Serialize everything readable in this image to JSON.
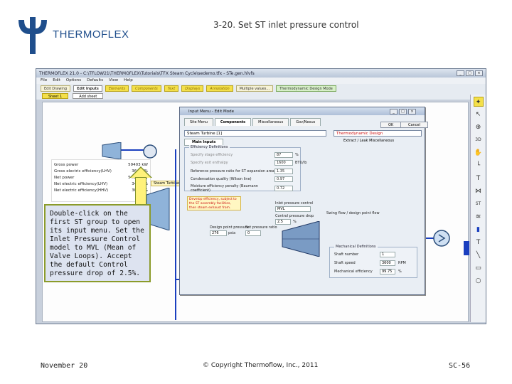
{
  "brand": {
    "name": "THERMOFLEX",
    "color": "#1f4e8c"
  },
  "slide": {
    "title": "3-20. Set ST inlet pressure control",
    "footer_left": "November 20",
    "footer_center": "© Copyright Thermoflow, Inc., 2011",
    "footer_right": "SC-56"
  },
  "callout": {
    "text": "Double-click on the first ST group to open its input menu. Set the Inlet Pressure Control model to MVL (Mean of Valve Loops). Accept the default Control pressure drop of 2.5%."
  },
  "app": {
    "title": "THERMOFLEX 21.0 - C:\\TFLOW21\\THERMOFLEX\\Tutorials\\TFX Steam Cycle\\sedemo.tfx - STe.gen.hlvfs",
    "menu": [
      "File",
      "Edit",
      "Options",
      "Defaults",
      "View",
      "Help"
    ],
    "toolbar": [
      "Edit Drawing",
      "Edit Inputs",
      "Elements",
      "Components",
      "Text",
      "Displays",
      "Annotation",
      "Multiple values...",
      "Thermodynamic Design Mode"
    ],
    "sheet_tabs": [
      "Sheet 1",
      "Add sheet"
    ],
    "results": [
      {
        "label": "Gross power",
        "value": "59403 kW"
      },
      {
        "label": "Gross electric efficiency(LHV)",
        "value": "36.31 %"
      },
      {
        "label": "Net power",
        "value": "54041 kW"
      },
      {
        "label": "Net electric efficiency(LHV)",
        "value": "34.09 %"
      },
      {
        "label": "Net electric efficiency(HHV)",
        "value": "30.69 %"
      }
    ],
    "steam_turbine_label": "Steam Turbine 1 ST Gro",
    "right_tool_labels": [
      "3D",
      "ST"
    ]
  },
  "dialog": {
    "title": "Input Menu - Edit Mode",
    "tabs": [
      "Site Menu",
      "Components",
      "Miscellaneous",
      "Gov/Nexus"
    ],
    "component_select": "Steam Turbine [1]",
    "mode_select": "Thermodynamic Design",
    "ok_label": "OK",
    "cancel_label": "Cancel",
    "sub_tabs": [
      "Main Inputs"
    ],
    "sub_right": "Extract / Leak Miscellaneous",
    "efficiency_title": "Efficiency Definitions",
    "fields": [
      {
        "label": "Specify stage efficiency",
        "value": "87",
        "unit": "%"
      },
      {
        "label": "Specify exit enthalpy",
        "value": "1600",
        "unit": "BTU/lb"
      },
      {
        "label": "Reference pressure ratio for ST expansion area",
        "value": "1.35",
        "unit": ""
      },
      {
        "label": "Condensation quality (Wilson line)",
        "value": "0.97",
        "unit": ""
      },
      {
        "label": "Moisture efficiency penalty (Baumann coefficient)",
        "value": "0.72",
        "unit": ""
      }
    ],
    "warning": "Develop efficiency, subject to the ST assembly facilities, then steam exhaust from.",
    "inlet_control_label": "Inlet pressure control",
    "inlet_control_value": "MVL",
    "control_dp_label": "Control pressure drop",
    "control_dp_value": "2.5",
    "control_dp_unit": "%",
    "design_pp_label": "Design point pressure",
    "design_pp_value": "276",
    "design_pp_unit": "psia",
    "set_pressure_label": "Set pressure ratio",
    "set_pressure_value": "0",
    "swing_label": "Swing flow / design point flow",
    "mech_title": "Mechanical Definitions",
    "shaft_label": "Shaft number",
    "shaft_value": "1",
    "speed_label": "Shaft speed",
    "speed_value": "3600",
    "speed_unit": "RPM",
    "mech_eff_label": "Mechanical efficiency",
    "mech_eff_value": "99.75",
    "mech_eff_unit": "%"
  },
  "colors": {
    "highlight": "#f4e04a",
    "pipe": "#1a3fbf",
    "callout_bg": "#dde3f0"
  }
}
